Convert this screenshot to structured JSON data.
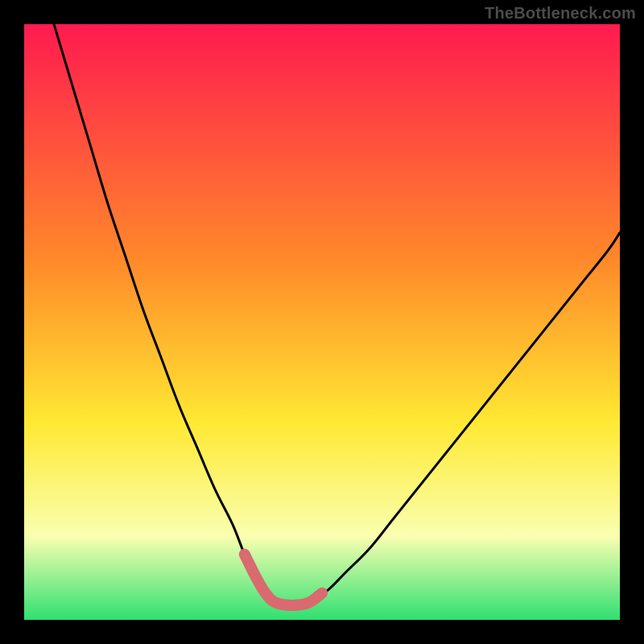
{
  "watermark": "TheBottleneck.com",
  "colors": {
    "frame": "#000000",
    "grad_top": "#ff1a4f",
    "grad_mid1": "#ff8a2a",
    "grad_mid2": "#ffe933",
    "grad_mid3": "#f9ffb0",
    "grad_bottom": "#2fe072",
    "curve": "#000000",
    "highlight": "#d96a6f"
  },
  "chart_data": {
    "type": "line",
    "title": "",
    "xlabel": "",
    "ylabel": "",
    "xlim": [
      0,
      100
    ],
    "ylim": [
      0,
      100
    ],
    "series": [
      {
        "name": "bottleneck-curve",
        "x": [
          5,
          8,
          11,
          14,
          17,
          20,
          23,
          26,
          29,
          32,
          35,
          37,
          39,
          40.5,
          42,
          44,
          46,
          48,
          51,
          54,
          58,
          62,
          66,
          70,
          74,
          78,
          82,
          86,
          90,
          94,
          98,
          100
        ],
        "y": [
          100,
          90,
          80,
          70,
          61,
          52,
          44,
          36,
          29,
          22,
          16,
          11,
          7,
          4.5,
          3,
          2.5,
          2.5,
          3,
          5,
          8,
          12,
          17,
          22,
          27,
          32,
          37,
          42,
          47,
          52,
          57,
          62,
          65
        ]
      },
      {
        "name": "valley-highlight",
        "x": [
          37,
          39,
          40.5,
          42,
          44,
          46,
          48,
          50
        ],
        "y": [
          11,
          7,
          4.5,
          3,
          2.5,
          2.5,
          3,
          4.5
        ]
      }
    ],
    "gradient_stops": [
      {
        "pos": 0.0,
        "color": "#ff1a4f"
      },
      {
        "pos": 0.4,
        "color": "#ff8a2a"
      },
      {
        "pos": 0.67,
        "color": "#ffe933"
      },
      {
        "pos": 0.86,
        "color": "#f9ffb0"
      },
      {
        "pos": 1.0,
        "color": "#2fe072"
      }
    ]
  }
}
